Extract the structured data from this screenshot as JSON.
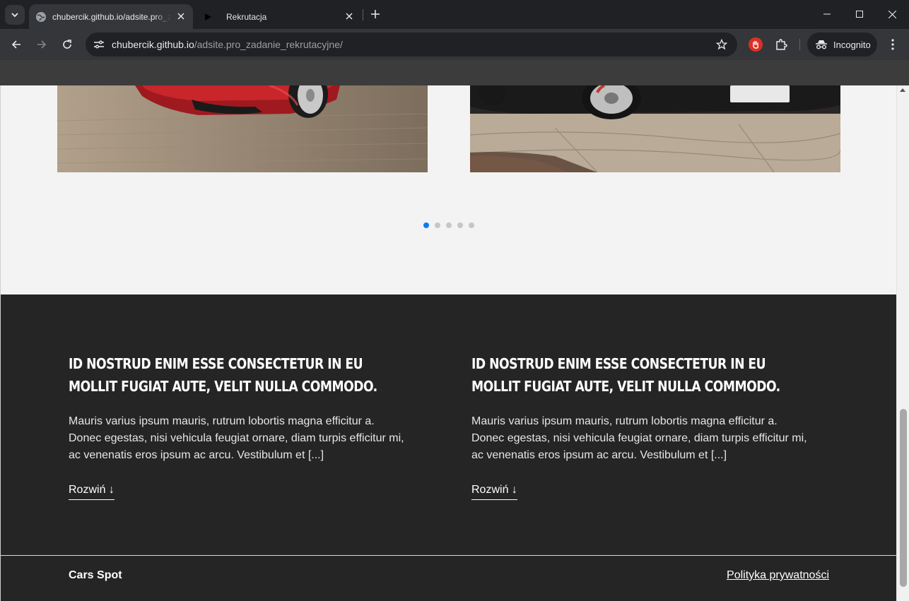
{
  "browser": {
    "tabs": [
      {
        "title": "chubercik.github.io/adsite.pro_zadanie_rekrutacyjne/",
        "active": true
      },
      {
        "title": "Rekrutacja",
        "active": false
      }
    ],
    "url_host": "chubercik.github.io",
    "url_path": "/adsite.pro_zadanie_rekrutacyjne/",
    "incognito_label": "Incognito"
  },
  "carousel": {
    "dot_count": 5,
    "active_index": 0
  },
  "articles": [
    {
      "heading": "Id nostrud enim esse consectetur in eu mollit fugiat aute, velit nulla commodo.",
      "text": "Mauris varius ipsum mauris, rutrum lobortis magna efficitur a. Donec egestas, nisi vehicula feugiat ornare, diam turpis efficitur mi, ac venenatis eros ipsum ac arcu. Vestibulum et [...]",
      "more_label": "Rozwiń ↓"
    },
    {
      "heading": "Id nostrud enim esse consectetur in eu mollit fugiat aute, velit nulla commodo.",
      "text": "Mauris varius ipsum mauris, rutrum lobortis magna efficitur a. Donec egestas, nisi vehicula feugiat ornare, diam turpis efficitur mi, ac venenatis eros ipsum ac arcu. Vestibulum et [...]",
      "more_label": "Rozwiń ↓"
    }
  ],
  "footer": {
    "brand": "Cars Spot",
    "privacy_link": "Polityka prywatności"
  },
  "colors": {
    "accent": "#0d7bf2",
    "dark_bg": "#252525",
    "page_bg": "#f3f3f3"
  }
}
